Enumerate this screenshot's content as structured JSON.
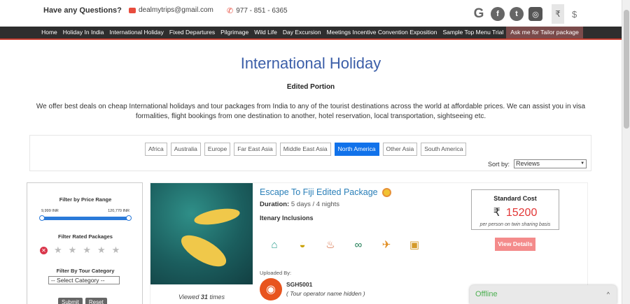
{
  "topbar": {
    "question": "Have any Questions?",
    "email": "dealmytrips@gmail.com",
    "phone": "977 - 851 - 6365",
    "rupee": "₹",
    "dollar": "$"
  },
  "nav": {
    "items": [
      "Home",
      "Holiday In India",
      "International Holiday",
      "Fixed Departures",
      "Pilgrimage",
      "Wild Life",
      "Day Excursion",
      "Meetings Incentive Convention Exposition",
      "Sample Top Menu Trial",
      "Ask me for Tailor package"
    ]
  },
  "page": {
    "title": "International Holiday",
    "subtitle": "Edited Portion",
    "description": "We offer best deals on cheap International holidays and tour packages from India to any of the tourist destinations across the world at affordable prices. We can assist you in visa formalities, flight bookings from one destination to another, hotel reservation, local transportation, sightseeing etc."
  },
  "filters": {
    "regions": [
      "Africa",
      "Australia",
      "Europe",
      "Far East Asia",
      "Middle East Asia",
      "North America",
      "Other Asia",
      "South America"
    ],
    "active_region": "North America",
    "sort_label": "Sort by:",
    "sort_value": "Reviews"
  },
  "sidebar": {
    "price_title": "Filter by Price Range",
    "price_min": "9,999 INR",
    "price_max": "120,770 INR",
    "rated_title": "Filter Rated Packages",
    "category_title": "Filter By Tour Category",
    "category_value": "-- Select Category --",
    "submit": "Submit",
    "reset": "Reset"
  },
  "card": {
    "name": "Escape To Fiji Edited Package",
    "duration_label": "Duration:",
    "duration_value": "5 days / 4 nights",
    "inclusions_label": "Itenary Inclusions",
    "views_prefix": "Viewed",
    "views_count": "31",
    "views_suffix": "times",
    "uploaded_label": "Uploaded By:",
    "operator_code": "SGH5001",
    "operator_note": "( Tour operator name hidden )",
    "cost_label": "Standard Cost",
    "currency": "₹",
    "cost_value": "15200",
    "cost_note": "per person on twin sharing basis",
    "view_button": "View Details"
  },
  "chat": {
    "status": "Offline",
    "caret": "^"
  }
}
